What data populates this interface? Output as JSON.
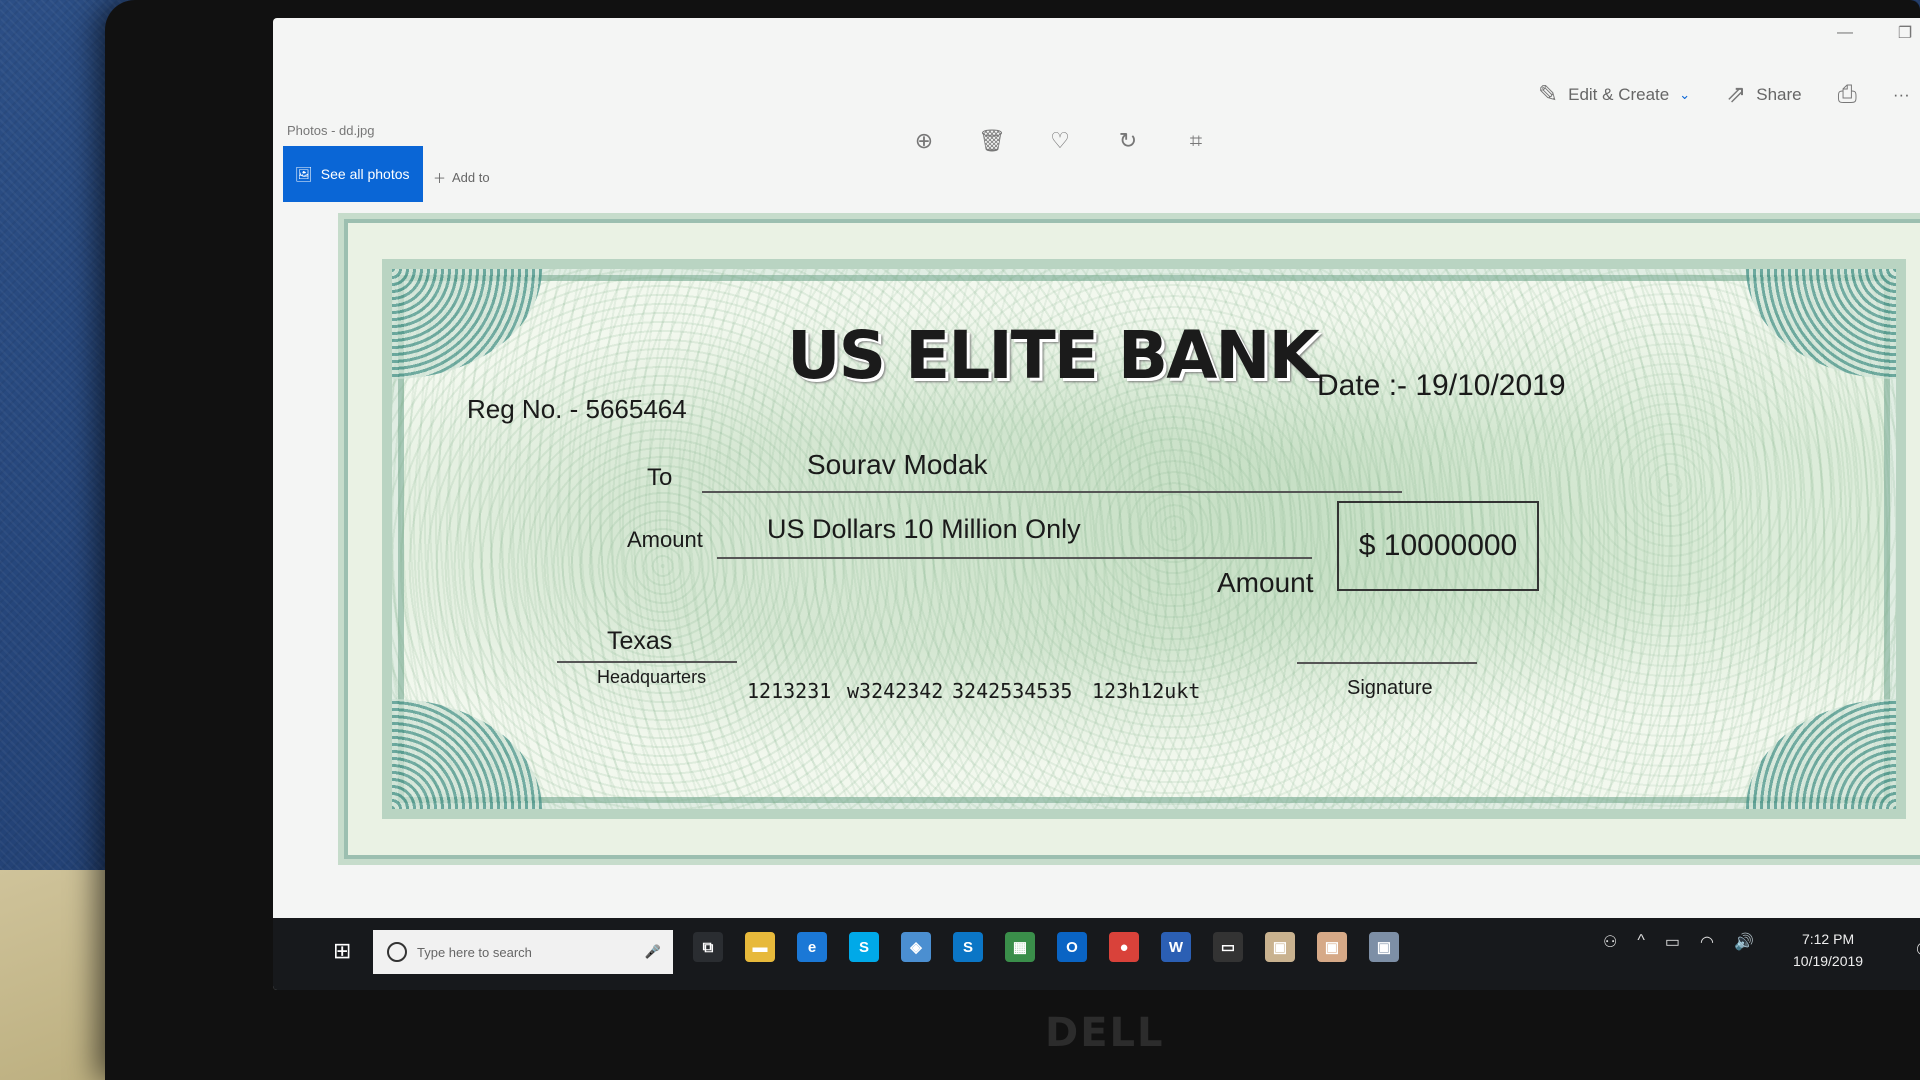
{
  "window": {
    "title": "Photos - dd.jpg",
    "minimize": "—",
    "restore": "❐",
    "close": "✕"
  },
  "toolbar": {
    "see_all_photos": "See all photos",
    "add_to": "Add to",
    "edit_create": "Edit & Create",
    "share": "Share",
    "more": "···",
    "icons": [
      "zoom-in-icon",
      "delete-icon",
      "heart-icon",
      "rotate-icon",
      "crop-icon",
      "print-icon"
    ]
  },
  "cheque": {
    "bank_name": "US ELITE BANK",
    "reg_no": "Reg No. - 5665464",
    "date": "Date :- 19/10/2019",
    "to_label": "To",
    "payee": "Sourav Modak",
    "amount_label": "Amount",
    "amount_words": "US Dollars 10 Million Only",
    "amount_figure": "$ 10000000",
    "amount_label_2": "Amount",
    "city": "Texas",
    "headquarters": "Headquarters",
    "micr": [
      "1213231",
      "w3242342",
      "3242534535",
      "123h12ukt"
    ],
    "signature": "Signature"
  },
  "taskbar": {
    "search_placeholder": "Type here to search",
    "apps": [
      {
        "name": "task-view",
        "glyph": "⧉",
        "color": "#2a2d31"
      },
      {
        "name": "file-explorer",
        "glyph": "▬",
        "color": "#e7b93b"
      },
      {
        "name": "edge",
        "glyph": "e",
        "color": "#1b78d6"
      },
      {
        "name": "skype",
        "glyph": "S",
        "color": "#00a9e8"
      },
      {
        "name": "maps",
        "glyph": "◈",
        "color": "#4b8fd1"
      },
      {
        "name": "skype-business",
        "glyph": "S",
        "color": "#0b76c6"
      },
      {
        "name": "sheets",
        "glyph": "▦",
        "color": "#3a8e4a"
      },
      {
        "name": "outlook",
        "glyph": "O",
        "color": "#0a64c4"
      },
      {
        "name": "chrome",
        "glyph": "●",
        "color": "#d9423a"
      },
      {
        "name": "word",
        "glyph": "W",
        "color": "#2b5fb4"
      },
      {
        "name": "terminal",
        "glyph": "▭",
        "color": "#333"
      },
      {
        "name": "app-1",
        "glyph": "▣",
        "color": "#c9b28f"
      },
      {
        "name": "app-2",
        "glyph": "▣",
        "color": "#d6a987"
      },
      {
        "name": "photos",
        "glyph": "▣",
        "color": "#7d8fa6"
      }
    ],
    "time": "7:12 PM",
    "date": "10/19/2019"
  }
}
